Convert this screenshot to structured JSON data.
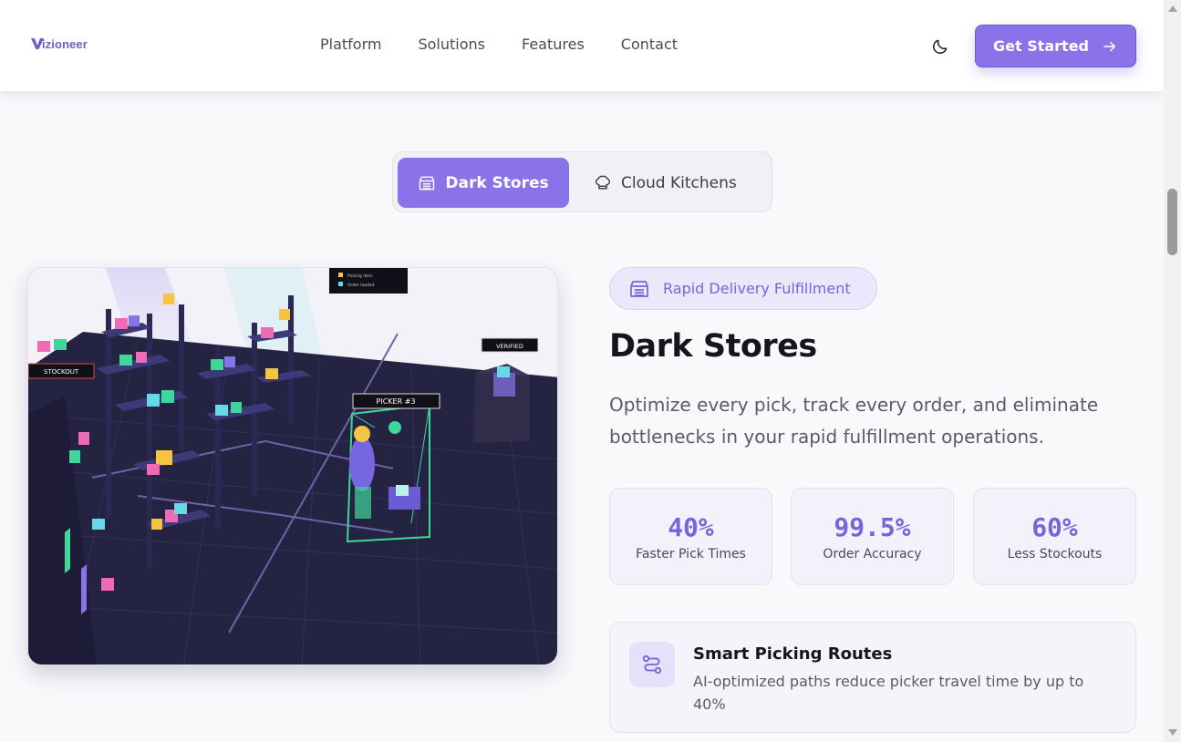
{
  "header": {
    "logo_text": "izioneer",
    "nav": [
      "Platform",
      "Solutions",
      "Features",
      "Contact"
    ],
    "theme_icon": "moon-icon",
    "cta_label": "Get Started",
    "cta_icon": "arrow-right-icon"
  },
  "tabs": [
    {
      "label": "Dark Stores",
      "icon": "store-icon",
      "active": true
    },
    {
      "label": "Cloud Kitchens",
      "icon": "chef-hat-icon",
      "active": false
    }
  ],
  "scene": {
    "labels": {
      "stockout": "STOCKOUT",
      "picker": "PICKER #3",
      "verified": "VERIFIED",
      "legend_1": "Picking item",
      "legend_2": "Order loaded"
    }
  },
  "content": {
    "badge": "Rapid Delivery Fulfillment",
    "badge_icon": "store-icon",
    "title": "Dark Stores",
    "description": "Optimize every pick, track every order, and eliminate bottlenecks in your rapid fulfillment operations.",
    "stats": [
      {
        "value": "40%",
        "label": "Faster Pick Times"
      },
      {
        "value": "99.5%",
        "label": "Order Accuracy"
      },
      {
        "value": "60%",
        "label": "Less Stockouts"
      }
    ],
    "feature": {
      "icon": "route-icon",
      "title": "Smart Picking Routes",
      "description": "AI-optimized paths reduce picker travel time by up to 40%"
    }
  },
  "colors": {
    "accent": "#8a73e8",
    "accent_dark": "#7a64db",
    "scene_floor": "#252342",
    "scene_green": "#3fd69a"
  }
}
